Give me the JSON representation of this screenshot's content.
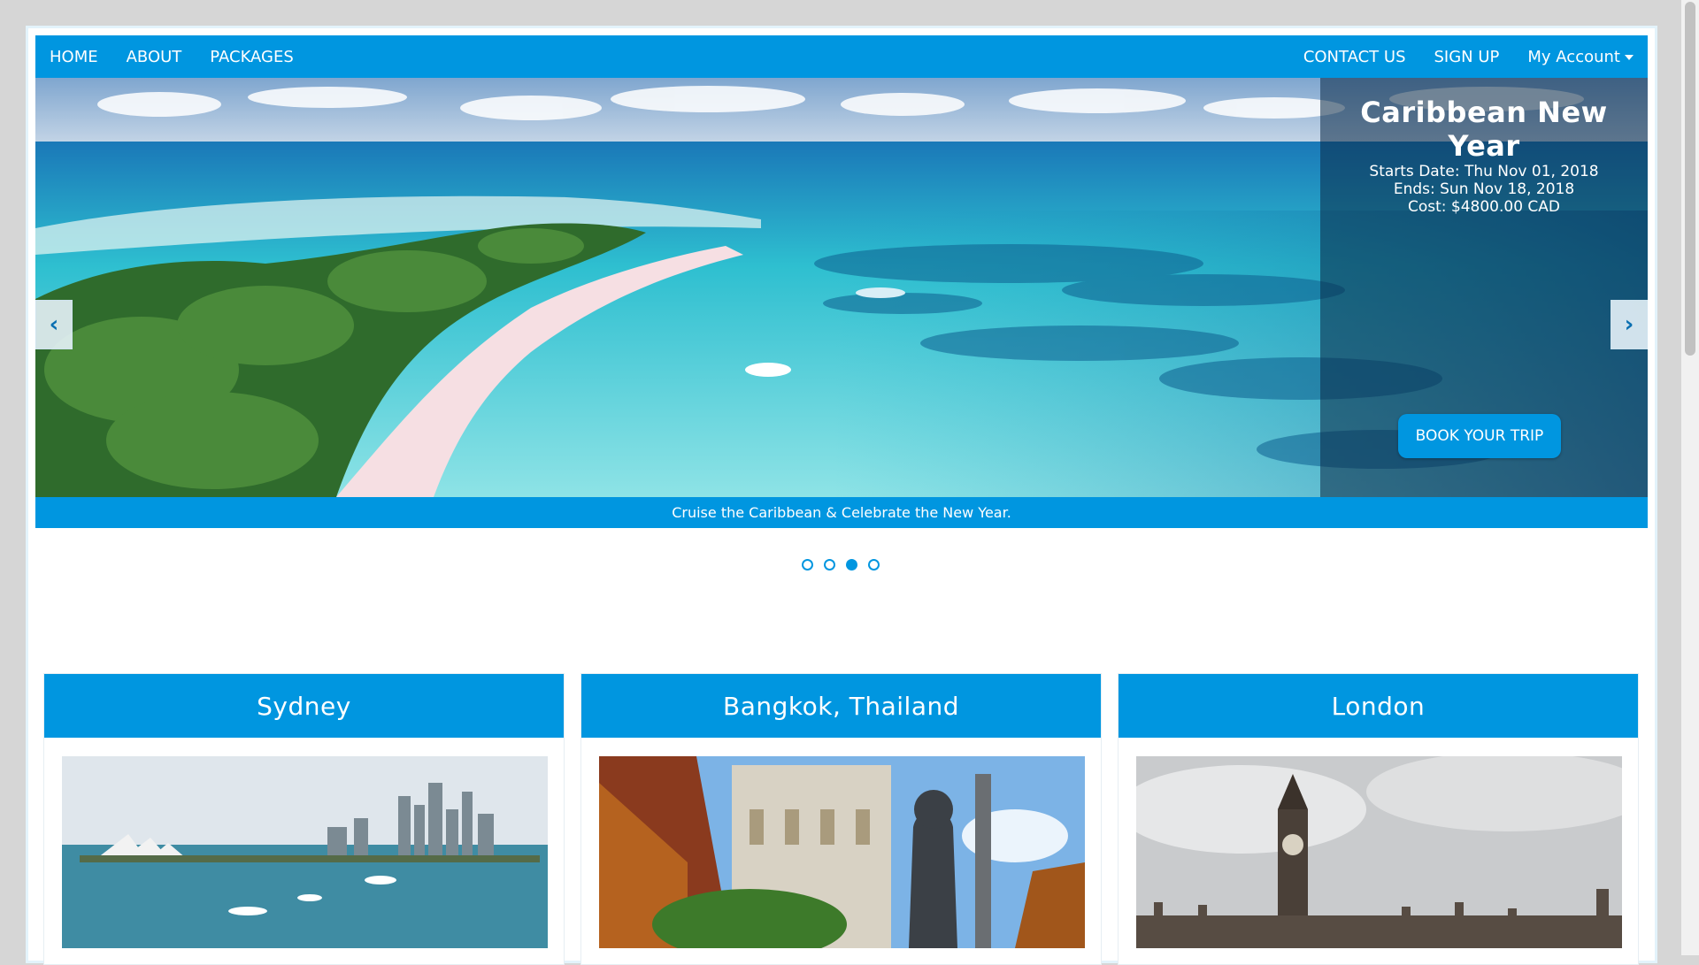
{
  "nav": {
    "left": [
      "HOME",
      "ABOUT",
      "PACKAGES"
    ],
    "contact": "CONTACT US",
    "signup": "SIGN UP",
    "account": "My Account"
  },
  "carousel": {
    "title": "Caribbean New Year",
    "start": "Starts Date: Thu Nov 01, 2018",
    "end": "Ends: Sun Nov 18, 2018",
    "cost": "Cost: $4800.00 CAD",
    "book_label": "BOOK YOUR TRIP",
    "prev_icon": "chevron-left-icon",
    "next_icon": "chevron-right-icon",
    "caption": "Cruise the Caribbean & Celebrate the New Year.",
    "slide_count": 4,
    "active_slide": 3
  },
  "destinations": [
    {
      "name": "Sydney"
    },
    {
      "name": "Bangkok, Thailand"
    },
    {
      "name": "London"
    }
  ],
  "colors": {
    "accent": "#0096e0"
  }
}
